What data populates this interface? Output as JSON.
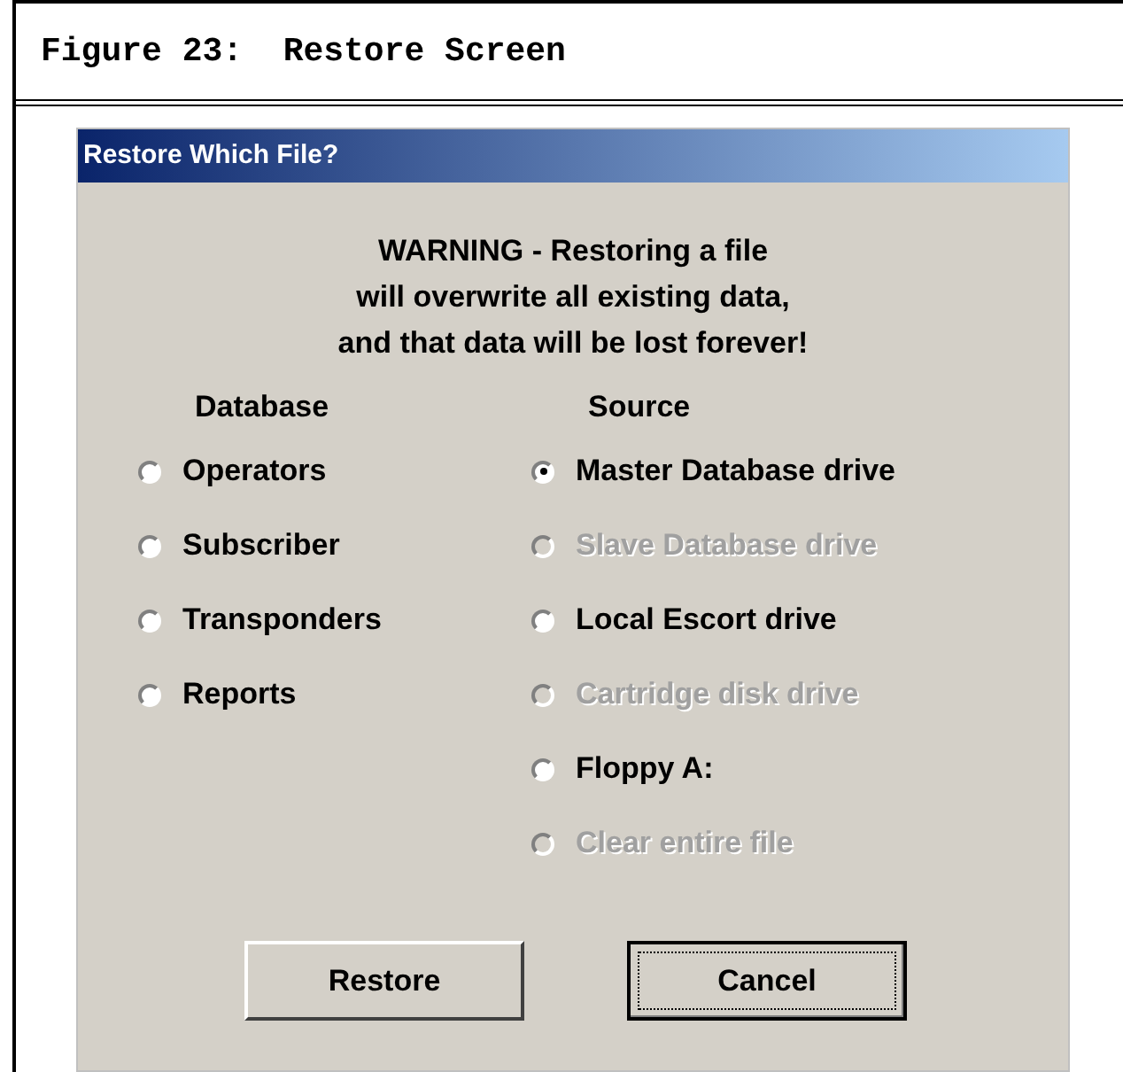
{
  "caption": "Figure 23:  Restore Screen",
  "dialog": {
    "title": "Restore Which File?",
    "warning": [
      "WARNING - Restoring a file",
      "will overwrite all existing data,",
      "and that data will be lost forever!"
    ],
    "database": {
      "heading": "Database",
      "options": [
        {
          "label": "Operators",
          "selected": false,
          "disabled": false
        },
        {
          "label": "Subscriber",
          "selected": false,
          "disabled": false
        },
        {
          "label": "Transponders",
          "selected": false,
          "disabled": false
        },
        {
          "label": "Reports",
          "selected": false,
          "disabled": false
        }
      ]
    },
    "source": {
      "heading": "Source",
      "options": [
        {
          "label": "Master Database drive",
          "selected": true,
          "disabled": false
        },
        {
          "label": "Slave Database drive",
          "selected": false,
          "disabled": true
        },
        {
          "label": "Local Escort drive",
          "selected": false,
          "disabled": false
        },
        {
          "label": "Cartridge disk drive",
          "selected": false,
          "disabled": true
        },
        {
          "label": "Floppy A:",
          "selected": false,
          "disabled": false
        },
        {
          "label": "Clear entire file",
          "selected": false,
          "disabled": true
        }
      ]
    },
    "buttons": [
      {
        "label": "Restore",
        "focused": false
      },
      {
        "label": "Cancel",
        "focused": true
      }
    ]
  }
}
